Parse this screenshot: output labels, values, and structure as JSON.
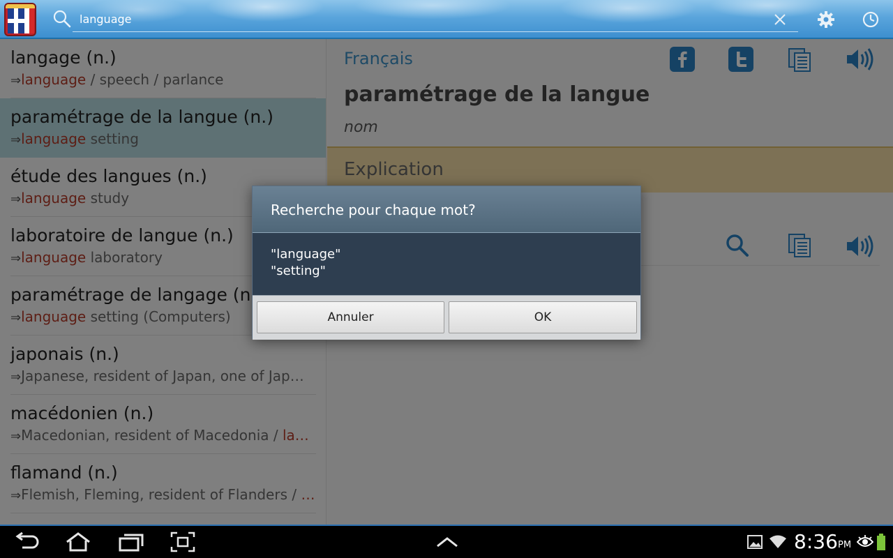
{
  "search": {
    "value": "language"
  },
  "results": [
    {
      "term": "langage (n.)",
      "arrow": "⇒",
      "highlight": "language",
      "rest": " / speech / parlance",
      "selected": false
    },
    {
      "term": "paramétrage de la langue (n.)",
      "arrow": "⇒",
      "highlight": "language",
      "rest": " setting",
      "selected": true
    },
    {
      "term": "étude des langues (n.)",
      "arrow": "⇒",
      "highlight": "language",
      "rest": " study",
      "selected": false
    },
    {
      "term": "laboratoire de langue (n.)",
      "arrow": "⇒",
      "highlight": "language",
      "rest": " laboratory",
      "selected": false
    },
    {
      "term": "paramétrage de langage (n.)",
      "arrow": "⇒",
      "highlight": "language",
      "rest": " setting (Computers)",
      "selected": false
    },
    {
      "term": "japonais (n.)",
      "arrow": "⇒",
      "highlight": "",
      "rest": "Japanese, resident of Japan, one of Jap…",
      "selected": false
    },
    {
      "term": "macédonien (n.)",
      "arrow": "⇒",
      "highlight": "",
      "rest": "Macedonian, resident of Macedonia / ",
      "tail_highlight": "la…",
      "selected": false
    },
    {
      "term": "flamand (n.)",
      "arrow": "⇒",
      "highlight": "",
      "rest": "Flemish, Fleming, resident of Flanders / ",
      "tail_highlight": "…",
      "selected": false
    }
  ],
  "detail": {
    "language": "Français",
    "headword": "paramétrage de la langue",
    "pos": "nom",
    "section": "Explication"
  },
  "dialog": {
    "title": "Recherche pour chaque mot?",
    "words": [
      "\"language\"",
      "\"setting\""
    ],
    "cancel_label": "Annuler",
    "ok_label": "OK"
  },
  "statusbar": {
    "time": "8:36",
    "ampm": "PM"
  },
  "colors": {
    "link_blue": "#3b8fc4",
    "highlight_red": "#b33a2a",
    "selected_row": "#b4d8df",
    "explication_bg": "#efd9a4",
    "dialog_bg": "#2e3e50"
  }
}
